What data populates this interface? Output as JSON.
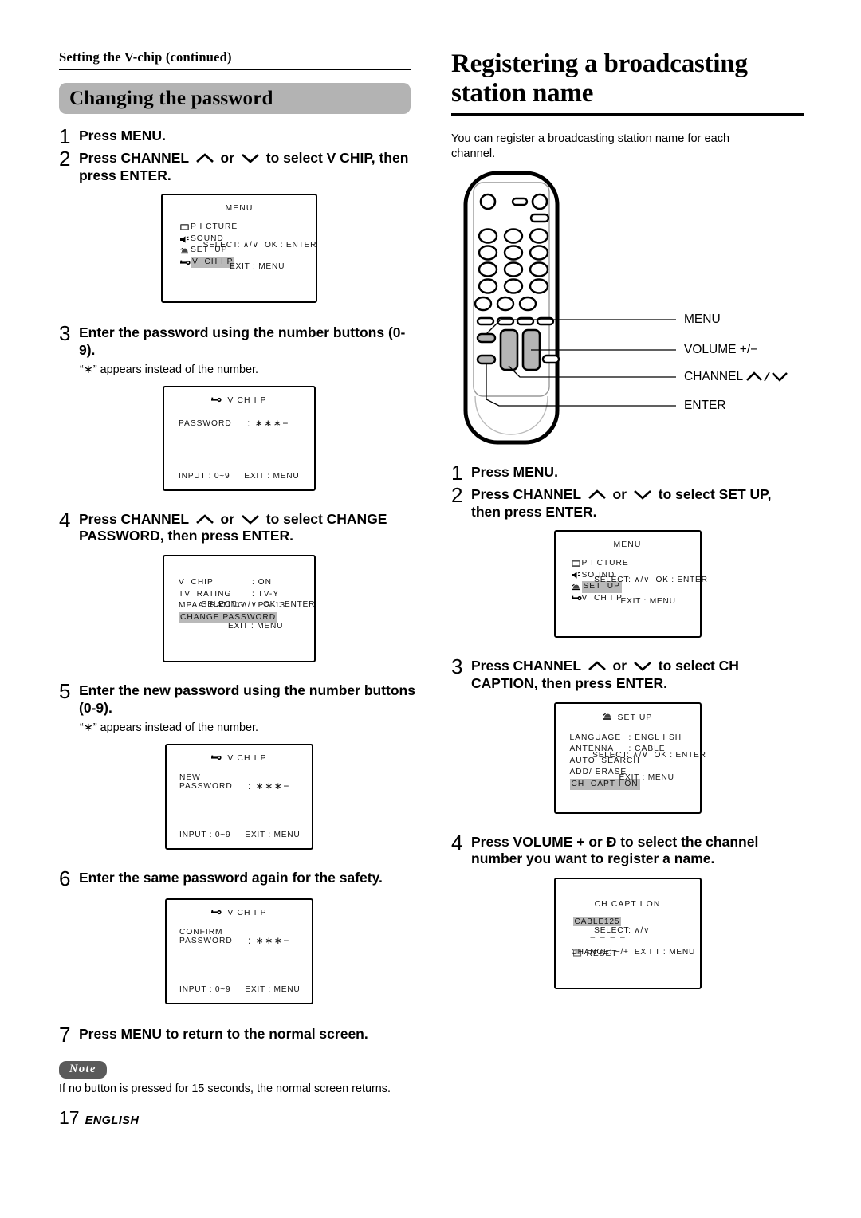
{
  "left": {
    "running_head": "Setting the V-chip (continued)",
    "section_title": "Changing the password",
    "steps": [
      {
        "num": "1",
        "text": "Press MENU."
      },
      {
        "num": "2",
        "text_a": "Press CHANNEL",
        "text_b": "or",
        "text_c": "to select V CHIP, then press ENTER."
      },
      {
        "num": "3",
        "text": "Enter the password using the number buttons (0-9).",
        "sub": "“∗” appears instead of the number."
      },
      {
        "num": "4",
        "text_a": "Press CHANNEL",
        "text_b": "or",
        "text_c": "to select CHANGE PASSWORD, then press ENTER."
      },
      {
        "num": "5",
        "text": "Enter the new password using the number buttons (0-9).",
        "sub": "“∗” appears instead of the number."
      },
      {
        "num": "6",
        "text": "Enter the same password again for the safety."
      },
      {
        "num": "7",
        "text": "Press MENU to return to the normal screen."
      }
    ],
    "osd_menu": {
      "title": "MENU",
      "items": [
        {
          "icon": "picture-icon",
          "label": "P I CTURE",
          "highlight": false
        },
        {
          "icon": "sound-icon",
          "label": "SOUND",
          "highlight": false
        },
        {
          "icon": "setup-icon",
          "label": "SET  UP",
          "highlight": false
        },
        {
          "icon": "key-icon",
          "label": "V  CH I P",
          "highlight": true
        }
      ],
      "foot_line1": "SELECT: ∧/∨  OK : ENTER",
      "foot_line2": "EXIT : MENU"
    },
    "osd_password": {
      "icon": "key-icon",
      "title": "V  CH I P",
      "key": "PASSWORD",
      "value": ": ∗∗∗−",
      "foot": "INPUT : 0~9     EXIT : MENU"
    },
    "osd_vchip_settings": {
      "rows": [
        {
          "label": "V  CHIP",
          "value": ": ON",
          "highlight": false
        },
        {
          "label": "TV  RATING",
          "value": ": TV-Y",
          "highlight": false
        },
        {
          "label": "MPAA  RATING",
          "value": ": PG-13",
          "highlight": false
        },
        {
          "label": "CHANGE PASSWORD",
          "value": "",
          "highlight": true
        }
      ],
      "foot_line1": "SELECT: ∧/∨  OK : ENTER",
      "foot_line2": "EXIT : MENU"
    },
    "osd_new_password": {
      "icon": "key-icon",
      "title": "V  CH I P",
      "key_line1": "NEW",
      "key_line2": "PASSWORD",
      "value": ": ∗∗∗−",
      "foot": "INPUT : 0~9     EXIT : MENU"
    },
    "osd_confirm_password": {
      "icon": "key-icon",
      "title": "V  CH I P",
      "key_line1": "CONFIRM",
      "key_line2": "PASSWORD",
      "value": ": ∗∗∗−",
      "foot": "INPUT : 0~9     EXIT : MENU"
    },
    "note": {
      "badge": "Note",
      "text": "If no button is pressed for 15 seconds, the normal screen returns."
    },
    "footer": {
      "page": "17",
      "language": "ENGLISH"
    }
  },
  "right": {
    "heading": "Registering a broadcasting station name",
    "intro": "You can register a broadcasting station name for each channel.",
    "remote_callouts": [
      {
        "label": "MENU"
      },
      {
        "label": "VOLUME +/−"
      },
      {
        "label": "CHANNEL"
      },
      {
        "label": "ENTER"
      }
    ],
    "steps": [
      {
        "num": "1",
        "text": "Press MENU."
      },
      {
        "num": "2",
        "text_a": "Press CHANNEL",
        "text_b": "or",
        "text_c": "to select SET UP, then press ENTER."
      },
      {
        "num": "3",
        "text_a": "Press CHANNEL",
        "text_b": "or",
        "text_c": "to select CH CAPTION, then press ENTER."
      },
      {
        "num": "4",
        "text": "Press VOLUME + or Ð to select the channel number you want to register a name."
      }
    ],
    "osd_menu": {
      "title": "MENU",
      "items": [
        {
          "icon": "picture-icon",
          "label": "P I CTURE",
          "highlight": false
        },
        {
          "icon": "sound-icon",
          "label": "SOUND",
          "highlight": false
        },
        {
          "icon": "setup-icon",
          "label": "SET  UP",
          "highlight": true
        },
        {
          "icon": "key-icon",
          "label": "V  CH I P",
          "highlight": false
        }
      ],
      "foot_line1": "SELECT: ∧/∨  OK : ENTER",
      "foot_line2": "EXIT : MENU"
    },
    "osd_setup": {
      "icon": "setup-icon",
      "title": "SET  UP",
      "rows": [
        {
          "label": "LANGUAGE",
          "value": ": ENGL I SH",
          "highlight": false
        },
        {
          "label": "ANTENNA",
          "value": ": CABLE",
          "highlight": false
        },
        {
          "label": "AUTO  SEARCH",
          "value": "",
          "highlight": false
        },
        {
          "label": "ADD/ ERASE",
          "value": "",
          "highlight": false
        },
        {
          "label": "CH  CAPT I ON",
          "value": "",
          "highlight": true
        }
      ],
      "foot_line1": "SELECT: ∧/∨  OK : ENTER",
      "foot_line2": "EXIT : MENU"
    },
    "osd_ch_caption": {
      "title": "CH  CAPT I ON",
      "channel": "CABLE125",
      "dashes": "–  –  –  –",
      "reset_icon": "pointer-icon",
      "reset_label": "RESET",
      "foot_line1": "SELECT: ∧/∨",
      "foot_line2": "CHANGE: −/+  EX I T : MENU"
    }
  },
  "colors": {
    "band_gray": "#b3b3b3",
    "highlight_gray": "#b9b9b9",
    "note_badge": "#5a5a5a",
    "remote_button_gray": "#b5b5b5"
  }
}
